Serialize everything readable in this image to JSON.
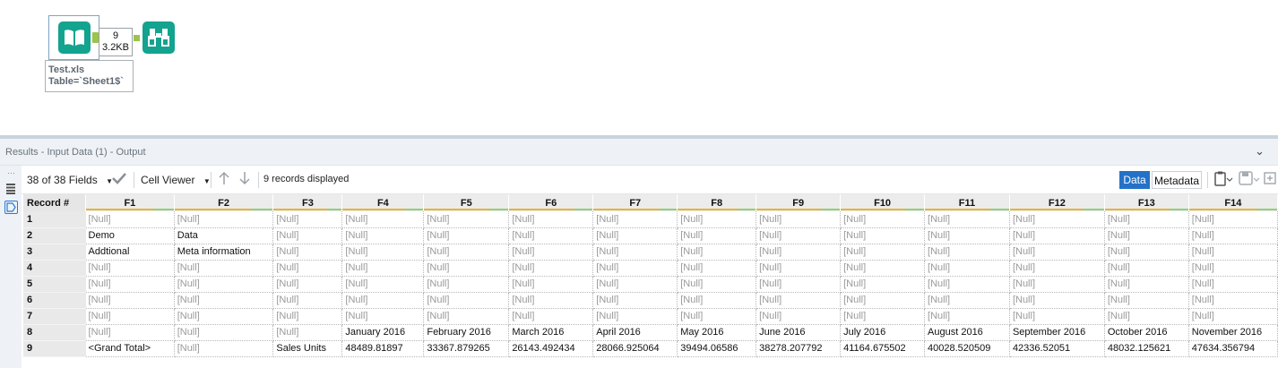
{
  "canvas": {
    "connection": {
      "records": "9",
      "size": "3.2KB"
    },
    "annotation": {
      "line1": "Test.xls",
      "line2": "Table=`Sheet1$`"
    },
    "tools": {
      "input_icon": "book-icon",
      "browse_icon": "binoculars-icon"
    },
    "colors": {
      "tool_teal": "#13a38f",
      "connector_green": "#9cc34a"
    }
  },
  "results": {
    "title": "Results - Input Data (1) - Output",
    "collapse_icon": "chevron-down-icon"
  },
  "toolbar": {
    "fields_selector": "38 of 38 Fields",
    "viewer_selector": "Cell Viewer",
    "records_status": "9 records displayed",
    "data_tab": "Data",
    "metadata_tab": "Metadata",
    "accent_color": "#2472c8"
  },
  "grid": {
    "record_header": "Record #",
    "columns": [
      "F1",
      "F2",
      "F3",
      "F4",
      "F5",
      "F6",
      "F7",
      "F8",
      "F9",
      "F10",
      "F11",
      "F12",
      "F13",
      "F14"
    ],
    "rows": [
      {
        "num": "1",
        "cells": [
          "[Null]",
          "[Null]",
          "[Null]",
          "[Null]",
          "[Null]",
          "[Null]",
          "[Null]",
          "[Null]",
          "[Null]",
          "[Null]",
          "[Null]",
          "[Null]",
          "[Null]",
          "[Null]"
        ]
      },
      {
        "num": "2",
        "cells": [
          "Demo",
          "Data",
          "[Null]",
          "[Null]",
          "[Null]",
          "[Null]",
          "[Null]",
          "[Null]",
          "[Null]",
          "[Null]",
          "[Null]",
          "[Null]",
          "[Null]",
          "[Null]"
        ]
      },
      {
        "num": "3",
        "cells": [
          "Addtional",
          "Meta information",
          "[Null]",
          "[Null]",
          "[Null]",
          "[Null]",
          "[Null]",
          "[Null]",
          "[Null]",
          "[Null]",
          "[Null]",
          "[Null]",
          "[Null]",
          "[Null]"
        ]
      },
      {
        "num": "4",
        "cells": [
          "[Null]",
          "[Null]",
          "[Null]",
          "[Null]",
          "[Null]",
          "[Null]",
          "[Null]",
          "[Null]",
          "[Null]",
          "[Null]",
          "[Null]",
          "[Null]",
          "[Null]",
          "[Null]"
        ]
      },
      {
        "num": "5",
        "cells": [
          "[Null]",
          "[Null]",
          "[Null]",
          "[Null]",
          "[Null]",
          "[Null]",
          "[Null]",
          "[Null]",
          "[Null]",
          "[Null]",
          "[Null]",
          "[Null]",
          "[Null]",
          "[Null]"
        ]
      },
      {
        "num": "6",
        "cells": [
          "[Null]",
          "[Null]",
          "[Null]",
          "[Null]",
          "[Null]",
          "[Null]",
          "[Null]",
          "[Null]",
          "[Null]",
          "[Null]",
          "[Null]",
          "[Null]",
          "[Null]",
          "[Null]"
        ]
      },
      {
        "num": "7",
        "cells": [
          "[Null]",
          "[Null]",
          "[Null]",
          "[Null]",
          "[Null]",
          "[Null]",
          "[Null]",
          "[Null]",
          "[Null]",
          "[Null]",
          "[Null]",
          "[Null]",
          "[Null]",
          "[Null]"
        ]
      },
      {
        "num": "8",
        "cells": [
          "[Null]",
          "[Null]",
          "[Null]",
          "January 2016",
          "February 2016",
          "March 2016",
          "April 2016",
          "May 2016",
          "June 2016",
          "July 2016",
          "August 2016",
          "September 2016",
          "October 2016",
          "November 2016"
        ]
      },
      {
        "num": "9",
        "cells": [
          "<Grand Total>",
          "[Null]",
          "Sales Units",
          "48489.81897",
          "33367.879265",
          "26143.492434",
          "28066.925064",
          "39494.06586",
          "38278.207792",
          "41164.675502",
          "40028.520509",
          "42336.52051",
          "48032.125621",
          "47634.356794"
        ]
      }
    ]
  }
}
